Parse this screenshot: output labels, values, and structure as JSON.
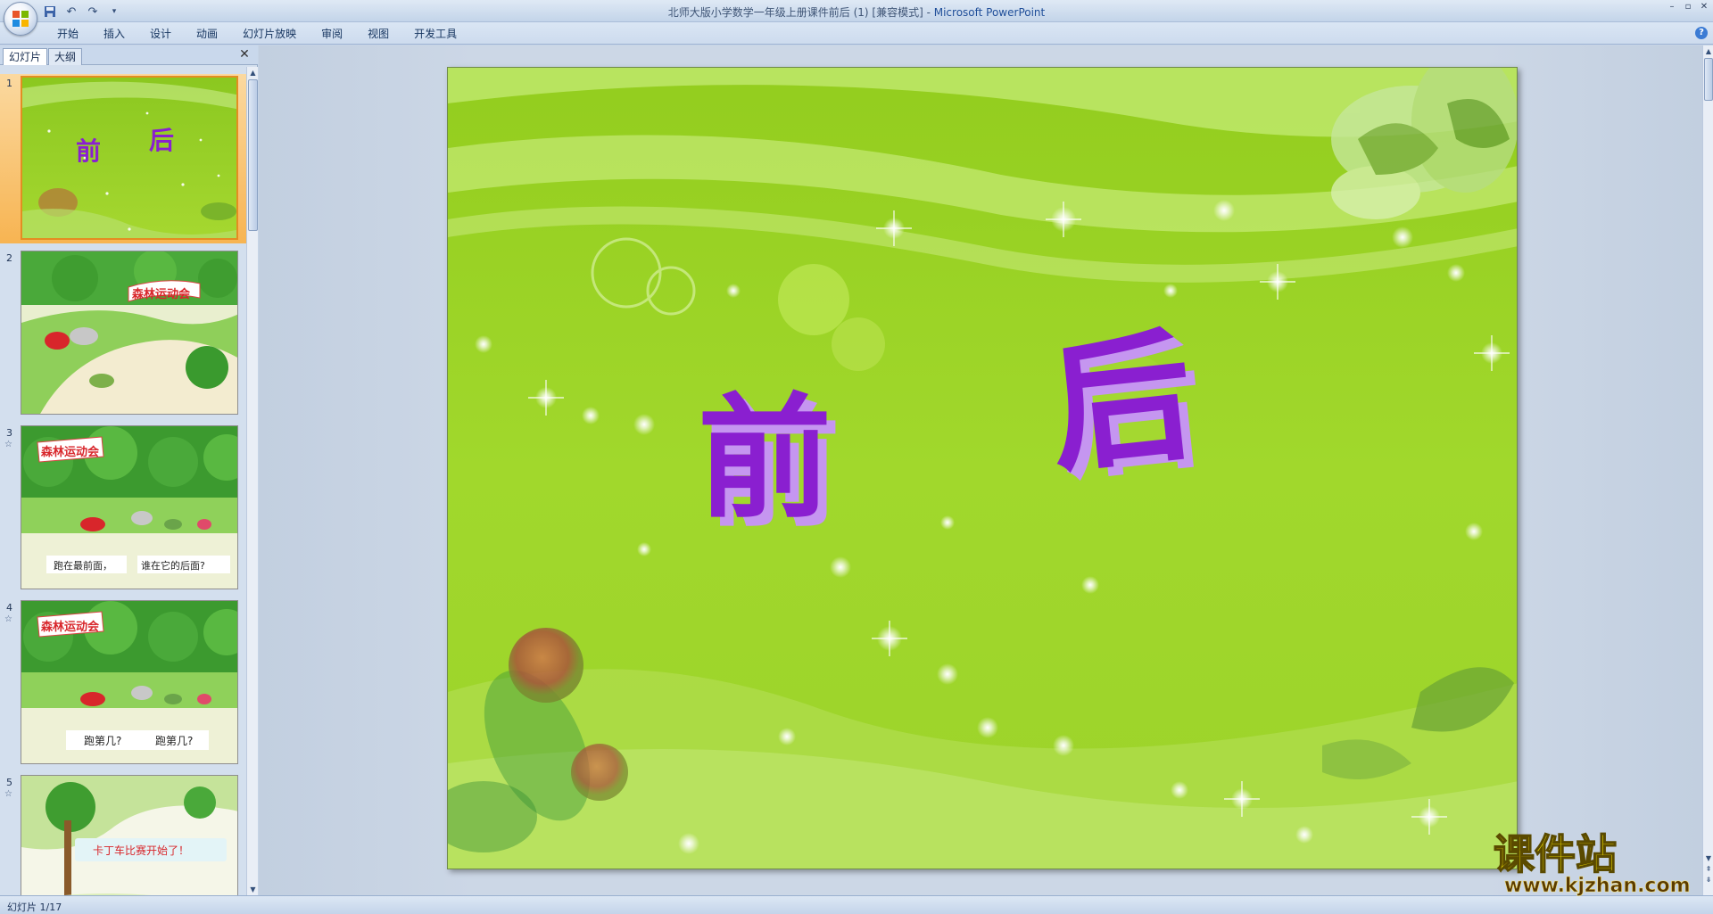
{
  "window": {
    "title": "北师大版小学数学一年级上册课件前后 (1) [兼容模式]",
    "separator": " - ",
    "app_name": "Microsoft PowerPoint"
  },
  "ribbon": {
    "tabs": [
      "开始",
      "插入",
      "设计",
      "动画",
      "幻灯片放映",
      "审阅",
      "视图",
      "开发工具"
    ]
  },
  "left_pane": {
    "tab_slides": "幻灯片",
    "tab_outline": "大纲",
    "slides": [
      {
        "number": "1",
        "selected": true
      },
      {
        "number": "2",
        "banner": "森林运动会"
      },
      {
        "number": "3",
        "banner": "森林运动会",
        "caption_a": "跑在最前面，",
        "caption_b": "谁在它的后面?"
      },
      {
        "number": "4",
        "banner": "森林运动会",
        "caption_a": "跑第几?",
        "caption_b": "跑第几?"
      },
      {
        "number": "5",
        "banner": "卡丁车比赛开始了！"
      }
    ]
  },
  "slide": {
    "char_front": "前",
    "char_back": "后",
    "colors": {
      "background": "#9fd42a",
      "title": "#8a1fd0",
      "title_shadow": "#c596f0"
    }
  },
  "status": {
    "slide_indicator": "幻灯片 1/17"
  },
  "watermark": {
    "brand": "课件站",
    "url": "www.kjzhan.com"
  }
}
